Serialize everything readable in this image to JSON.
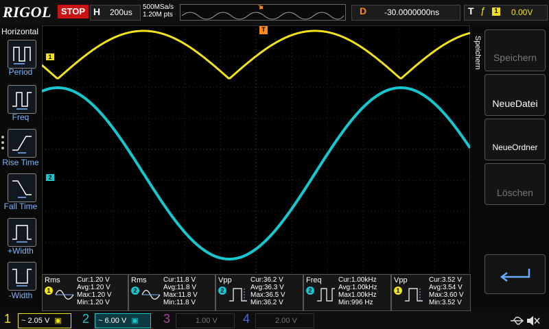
{
  "brand": "RIGOL",
  "run_state": "STOP",
  "horizontal": {
    "label": "H",
    "timebase": "200us"
  },
  "sample": {
    "rate": "500MSa/s",
    "points": "1.20M pts"
  },
  "memory_marker": "T",
  "delay": {
    "label": "D",
    "value": "-30.0000000ns"
  },
  "trigger": {
    "label": "T",
    "edge_symbol": "ƒ",
    "source": "1",
    "level": "0.00V"
  },
  "left_menu": {
    "title": "Horizontal",
    "items": [
      {
        "label": "Period",
        "icon": "period-icon"
      },
      {
        "label": "Freq",
        "icon": "freq-icon"
      },
      {
        "label": "Rise Time",
        "icon": "rise-time-icon"
      },
      {
        "label": "Fall Time",
        "icon": "fall-time-icon"
      },
      {
        "label": "+Width",
        "icon": "pos-width-icon"
      },
      {
        "label": "-Width",
        "icon": "neg-width-icon"
      }
    ]
  },
  "right_menu": {
    "title": "Speichern",
    "buttons": [
      {
        "label": "Speichern",
        "enabled": false
      },
      {
        "label": "NeueDatei",
        "enabled": true
      },
      {
        "label": "NeueOrdner",
        "enabled": true
      },
      {
        "label": "Löschen",
        "enabled": false
      },
      {
        "label": "↵",
        "enabled": true,
        "icon": "return-icon"
      }
    ]
  },
  "channel_markers": {
    "ch1": "1",
    "ch2": "2",
    "trigger_marker": "T"
  },
  "measurements": [
    {
      "name": "Rms",
      "channel": "1",
      "cur": "Cur:1.20 V",
      "avg": "Avg:1.20 V",
      "max": "Max:1.20 V",
      "min": "Min:1.20 V"
    },
    {
      "name": "Rms",
      "channel": "2",
      "cur": "Cur:11.8 V",
      "avg": "Avg:11.8 V",
      "max": "Max:11.8 V",
      "min": "Min:11.8 V"
    },
    {
      "name": "Vpp",
      "channel": "2",
      "cur": "Cur:36.2 V",
      "avg": "Avg:36.3 V",
      "max": "Max:36.5 V",
      "min": "Min:36.2 V"
    },
    {
      "name": "Freq",
      "channel": "2",
      "cur": "Cur:1.00kHz",
      "avg": "Avg:1.00kHz",
      "max": "Max1.00kHz",
      "min": "Min:996 Hz"
    },
    {
      "name": "Vpp",
      "channel": "1",
      "cur": "Cur:3.52 V",
      "avg": "Avg:3.54 V",
      "max": "Max:3.60 V",
      "min": "Min:3.52 V"
    }
  ],
  "channels": [
    {
      "num": "1",
      "coupling": "~",
      "scale": "2.05 V",
      "color": "#f2e21c",
      "active": true
    },
    {
      "num": "2",
      "coupling": "~",
      "scale": "6.00 V",
      "color": "#15c8d0",
      "active": true
    },
    {
      "num": "3",
      "coupling": "",
      "scale": "1.00 V",
      "color": "#a9409c",
      "active": false
    },
    {
      "num": "4",
      "coupling": "",
      "scale": "2.00 V",
      "color": "#4c6bd6",
      "active": false
    }
  ],
  "colors": {
    "ch1": "#f2e21c",
    "ch2": "#15c8d0",
    "accent": "#ff8a1a",
    "stop": "#c81414"
  }
}
